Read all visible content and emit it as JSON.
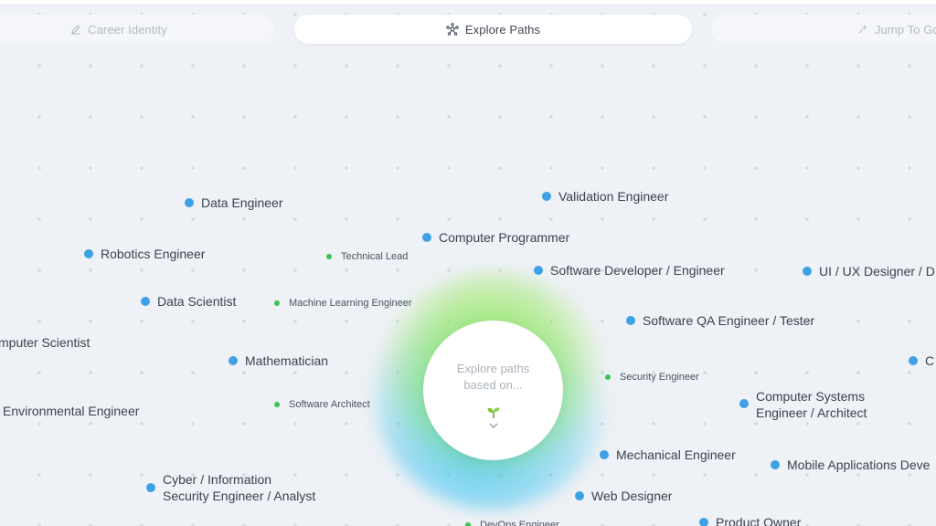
{
  "tabs": {
    "career": {
      "label": "Career Identity",
      "icon": "edit-icon"
    },
    "explore": {
      "label": "Explore Paths",
      "icon": "network-icon"
    },
    "jump": {
      "label": "Jump To Go",
      "icon": "sparkle-icon"
    }
  },
  "center": {
    "text": "Explore paths based on...",
    "icon": "sprout-icon",
    "expand_icon": "chevron-down-icon"
  },
  "colors": {
    "primary_dot": "#3ea1e6",
    "secondary_dot": "#3cc353",
    "glow_green": "#82e63c",
    "glow_blue": "#28bef0"
  },
  "nodes": [
    {
      "id": "data-engineer",
      "label": "Data Engineer"
    },
    {
      "id": "validation-engineer",
      "label": "Validation Engineer"
    },
    {
      "id": "robotics-engineer",
      "label": "Robotics Engineer"
    },
    {
      "id": "technical-lead",
      "label": "Technical Lead"
    },
    {
      "id": "computer-programmer",
      "label": "Computer Programmer"
    },
    {
      "id": "software-developer",
      "label": "Software Developer / Engineer"
    },
    {
      "id": "ui-ux-designer",
      "label": "UI / UX Designer / D"
    },
    {
      "id": "data-scientist",
      "label": "Data Scientist"
    },
    {
      "id": "machine-learning-engineer",
      "label": "Machine Learning Engineer"
    },
    {
      "id": "software-qa-engineer",
      "label": "Software QA Engineer / Tester"
    },
    {
      "id": "computer-scientist",
      "label": "mputer Scientist"
    },
    {
      "id": "mathematician",
      "label": "Mathematician"
    },
    {
      "id": "right-edge",
      "label": "C"
    },
    {
      "id": "security-engineer",
      "label": "Security Engineer"
    },
    {
      "id": "environmental-engineer",
      "label": "Environmental Engineer"
    },
    {
      "id": "software-architect",
      "label": "Software Architect"
    },
    {
      "id": "computer-systems-engineer",
      "label": "Computer Systems\nEngineer / Architect"
    },
    {
      "id": "mechanical-engineer",
      "label": "Mechanical Engineer"
    },
    {
      "id": "mobile-applications-developer",
      "label": "Mobile Applications Deve"
    },
    {
      "id": "cyber-security-engineer",
      "label": "Cyber / Information\nSecurity Engineer / Analyst"
    },
    {
      "id": "web-designer",
      "label": "Web Designer"
    },
    {
      "id": "devops-engineer",
      "label": "DevOps Engineer"
    },
    {
      "id": "product-owner",
      "label": "Product Owner"
    }
  ]
}
